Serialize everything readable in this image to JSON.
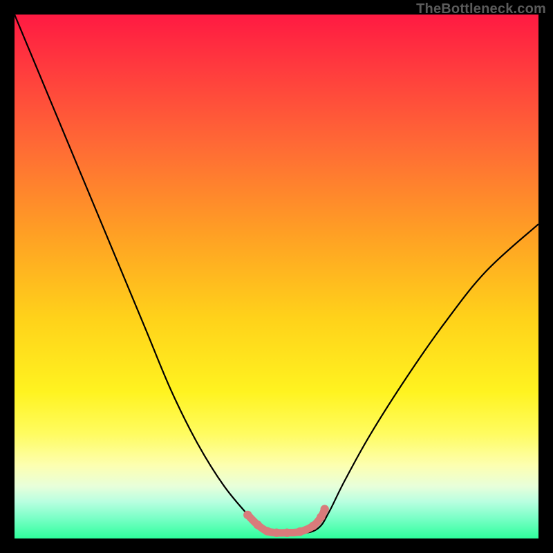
{
  "watermark": "TheBottleneck.com",
  "chart_data": {
    "type": "line",
    "title": "",
    "xlabel": "",
    "ylabel": "",
    "xlim": [
      0,
      100
    ],
    "ylim": [
      0,
      100
    ],
    "grid": false,
    "legend": false,
    "series": [
      {
        "name": "bottleneck-curve",
        "x": [
          0,
          5,
          10,
          15,
          20,
          25,
          30,
          35,
          40,
          45,
          48,
          50,
          55,
          58,
          60,
          63,
          68,
          75,
          82,
          90,
          100
        ],
        "values": [
          100,
          88,
          76,
          64,
          52,
          40,
          28,
          18,
          10,
          4,
          1,
          1,
          1,
          2,
          5,
          11,
          20,
          31,
          41,
          51,
          60
        ]
      }
    ],
    "markers": {
      "name": "highlight-dots",
      "color": "#d87b7b",
      "x": [
        44.5,
        46.4,
        48.2,
        50.0,
        52.0,
        54.5,
        57.0,
        58.5,
        59.2
      ],
      "values": [
        4.5,
        2.6,
        1.4,
        1.1,
        1.1,
        1.3,
        2.4,
        4.1,
        5.6
      ]
    },
    "background_gradient": {
      "top": "#ff1a42",
      "mid": "#fff320",
      "bottom": "#2eff9c"
    }
  }
}
